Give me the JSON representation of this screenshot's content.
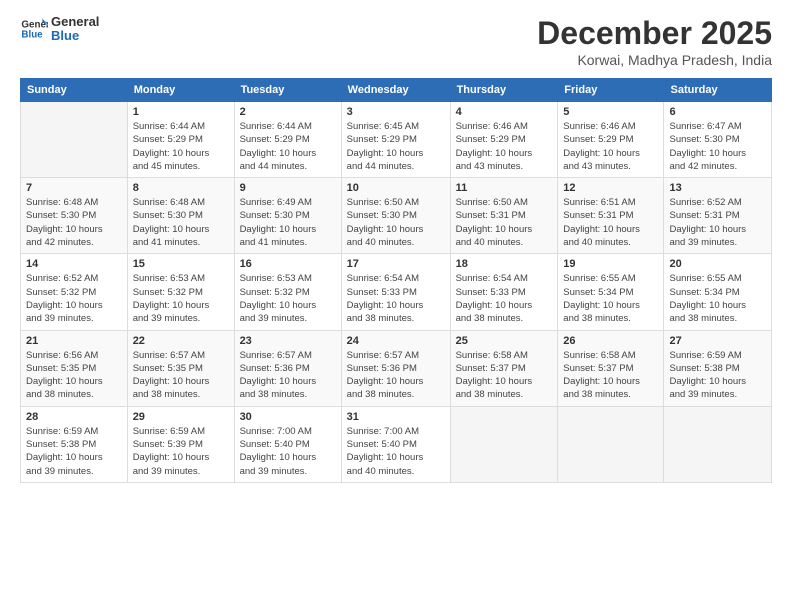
{
  "logo": {
    "text_general": "General",
    "text_blue": "Blue"
  },
  "header": {
    "title": "December 2025",
    "subtitle": "Korwai, Madhya Pradesh, India"
  },
  "calendar": {
    "columns": [
      "Sunday",
      "Monday",
      "Tuesday",
      "Wednesday",
      "Thursday",
      "Friday",
      "Saturday"
    ],
    "weeks": [
      [
        {
          "day": "",
          "info": ""
        },
        {
          "day": "1",
          "info": "Sunrise: 6:44 AM\nSunset: 5:29 PM\nDaylight: 10 hours\nand 45 minutes."
        },
        {
          "day": "2",
          "info": "Sunrise: 6:44 AM\nSunset: 5:29 PM\nDaylight: 10 hours\nand 44 minutes."
        },
        {
          "day": "3",
          "info": "Sunrise: 6:45 AM\nSunset: 5:29 PM\nDaylight: 10 hours\nand 44 minutes."
        },
        {
          "day": "4",
          "info": "Sunrise: 6:46 AM\nSunset: 5:29 PM\nDaylight: 10 hours\nand 43 minutes."
        },
        {
          "day": "5",
          "info": "Sunrise: 6:46 AM\nSunset: 5:29 PM\nDaylight: 10 hours\nand 43 minutes."
        },
        {
          "day": "6",
          "info": "Sunrise: 6:47 AM\nSunset: 5:30 PM\nDaylight: 10 hours\nand 42 minutes."
        }
      ],
      [
        {
          "day": "7",
          "info": "Sunrise: 6:48 AM\nSunset: 5:30 PM\nDaylight: 10 hours\nand 42 minutes."
        },
        {
          "day": "8",
          "info": "Sunrise: 6:48 AM\nSunset: 5:30 PM\nDaylight: 10 hours\nand 41 minutes."
        },
        {
          "day": "9",
          "info": "Sunrise: 6:49 AM\nSunset: 5:30 PM\nDaylight: 10 hours\nand 41 minutes."
        },
        {
          "day": "10",
          "info": "Sunrise: 6:50 AM\nSunset: 5:30 PM\nDaylight: 10 hours\nand 40 minutes."
        },
        {
          "day": "11",
          "info": "Sunrise: 6:50 AM\nSunset: 5:31 PM\nDaylight: 10 hours\nand 40 minutes."
        },
        {
          "day": "12",
          "info": "Sunrise: 6:51 AM\nSunset: 5:31 PM\nDaylight: 10 hours\nand 40 minutes."
        },
        {
          "day": "13",
          "info": "Sunrise: 6:52 AM\nSunset: 5:31 PM\nDaylight: 10 hours\nand 39 minutes."
        }
      ],
      [
        {
          "day": "14",
          "info": "Sunrise: 6:52 AM\nSunset: 5:32 PM\nDaylight: 10 hours\nand 39 minutes."
        },
        {
          "day": "15",
          "info": "Sunrise: 6:53 AM\nSunset: 5:32 PM\nDaylight: 10 hours\nand 39 minutes."
        },
        {
          "day": "16",
          "info": "Sunrise: 6:53 AM\nSunset: 5:32 PM\nDaylight: 10 hours\nand 39 minutes."
        },
        {
          "day": "17",
          "info": "Sunrise: 6:54 AM\nSunset: 5:33 PM\nDaylight: 10 hours\nand 38 minutes."
        },
        {
          "day": "18",
          "info": "Sunrise: 6:54 AM\nSunset: 5:33 PM\nDaylight: 10 hours\nand 38 minutes."
        },
        {
          "day": "19",
          "info": "Sunrise: 6:55 AM\nSunset: 5:34 PM\nDaylight: 10 hours\nand 38 minutes."
        },
        {
          "day": "20",
          "info": "Sunrise: 6:55 AM\nSunset: 5:34 PM\nDaylight: 10 hours\nand 38 minutes."
        }
      ],
      [
        {
          "day": "21",
          "info": "Sunrise: 6:56 AM\nSunset: 5:35 PM\nDaylight: 10 hours\nand 38 minutes."
        },
        {
          "day": "22",
          "info": "Sunrise: 6:57 AM\nSunset: 5:35 PM\nDaylight: 10 hours\nand 38 minutes."
        },
        {
          "day": "23",
          "info": "Sunrise: 6:57 AM\nSunset: 5:36 PM\nDaylight: 10 hours\nand 38 minutes."
        },
        {
          "day": "24",
          "info": "Sunrise: 6:57 AM\nSunset: 5:36 PM\nDaylight: 10 hours\nand 38 minutes."
        },
        {
          "day": "25",
          "info": "Sunrise: 6:58 AM\nSunset: 5:37 PM\nDaylight: 10 hours\nand 38 minutes."
        },
        {
          "day": "26",
          "info": "Sunrise: 6:58 AM\nSunset: 5:37 PM\nDaylight: 10 hours\nand 38 minutes."
        },
        {
          "day": "27",
          "info": "Sunrise: 6:59 AM\nSunset: 5:38 PM\nDaylight: 10 hours\nand 39 minutes."
        }
      ],
      [
        {
          "day": "28",
          "info": "Sunrise: 6:59 AM\nSunset: 5:38 PM\nDaylight: 10 hours\nand 39 minutes."
        },
        {
          "day": "29",
          "info": "Sunrise: 6:59 AM\nSunset: 5:39 PM\nDaylight: 10 hours\nand 39 minutes."
        },
        {
          "day": "30",
          "info": "Sunrise: 7:00 AM\nSunset: 5:40 PM\nDaylight: 10 hours\nand 39 minutes."
        },
        {
          "day": "31",
          "info": "Sunrise: 7:00 AM\nSunset: 5:40 PM\nDaylight: 10 hours\nand 40 minutes."
        },
        {
          "day": "",
          "info": ""
        },
        {
          "day": "",
          "info": ""
        },
        {
          "day": "",
          "info": ""
        }
      ]
    ]
  }
}
